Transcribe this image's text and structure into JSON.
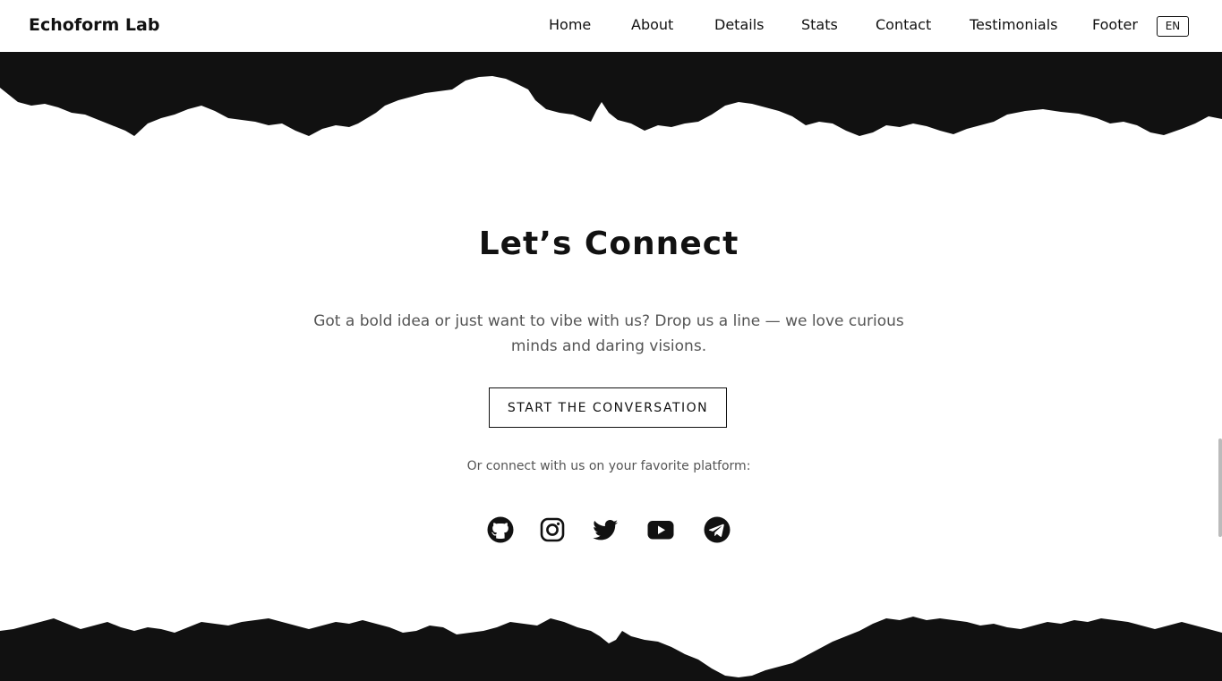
{
  "header": {
    "brand": "Echoform Lab",
    "nav": [
      "Home",
      "About",
      "Details",
      "Stats",
      "Contact",
      "Testimonials",
      "Footer"
    ],
    "language": "EN"
  },
  "contact": {
    "title": "Let’s Connect",
    "description": "Got a bold idea or just want to vibe with us? Drop us a line — we love curious minds and daring visions.",
    "cta_label": "START THE CONVERSATION",
    "platforms_text": "Or connect with us on your favorite platform:",
    "social_icons": [
      "github-icon",
      "instagram-icon",
      "twitter-icon",
      "youtube-icon",
      "telegram-icon"
    ]
  },
  "colors": {
    "ink": "#111111",
    "background": "#ffffff",
    "muted_text": "#555555"
  }
}
